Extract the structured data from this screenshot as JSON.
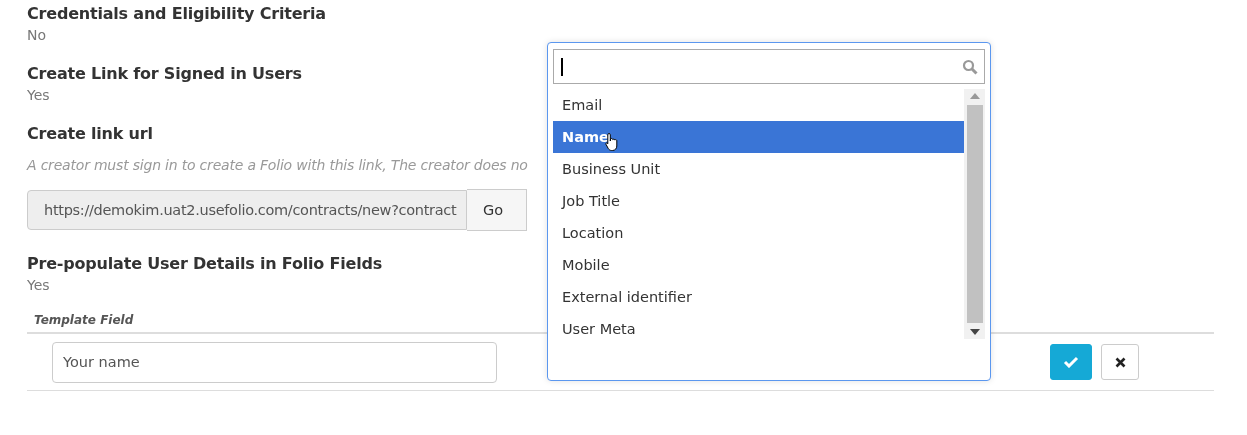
{
  "fields": [
    {
      "kind": "text",
      "title": "Credentials and Eligibility Criteria",
      "value": "No"
    },
    {
      "kind": "text",
      "title": "Create Link for Signed in Users",
      "value": "Yes"
    },
    {
      "kind": "link",
      "title": "Create link url",
      "help": "A creator must sign in to create a Folio with this link, The creator does no",
      "url": "https://demokim.uat2.usefolio.com/contracts/new?contract",
      "button": "Go"
    },
    {
      "kind": "text",
      "title": "Pre-populate User Details in Folio Fields",
      "value": "Yes"
    }
  ],
  "mapping_table": {
    "columns": [
      "Template Field"
    ],
    "rows": [
      {
        "template_field": "Your name"
      }
    ]
  },
  "dropdown": {
    "options": [
      {
        "label": "Email",
        "selected": false
      },
      {
        "label": "Name",
        "selected": true
      },
      {
        "label": "Business Unit",
        "selected": false
      },
      {
        "label": "Job Title",
        "selected": false
      },
      {
        "label": "Location",
        "selected": false
      },
      {
        "label": "Mobile",
        "selected": false
      },
      {
        "label": "External identifier",
        "selected": false
      },
      {
        "label": "User Meta",
        "selected": false
      }
    ]
  },
  "actions": [
    {
      "kind": "confirm"
    },
    {
      "kind": "cancel"
    }
  ]
}
